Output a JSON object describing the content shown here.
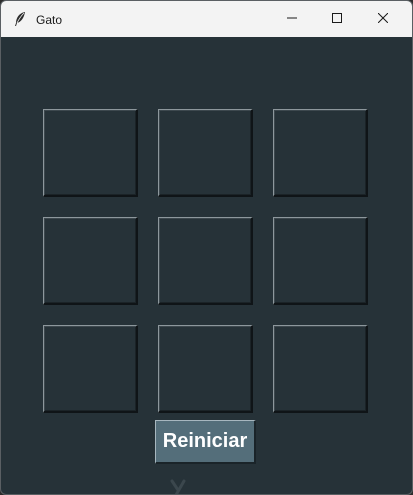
{
  "window": {
    "title": "Gato",
    "app_icon": "feather-icon",
    "controls": {
      "minimize_icon": "minimize-icon",
      "maximize_icon": "maximize-icon",
      "close_icon": "close-icon"
    }
  },
  "board": {
    "cells": [
      [
        "",
        "",
        ""
      ],
      [
        "",
        "",
        ""
      ],
      [
        "",
        "",
        ""
      ]
    ]
  },
  "reset_button": {
    "label": "Reiniciar"
  },
  "colors": {
    "background": "#263238",
    "button": "#546e7a",
    "titlebar": "#f3f3f3"
  }
}
